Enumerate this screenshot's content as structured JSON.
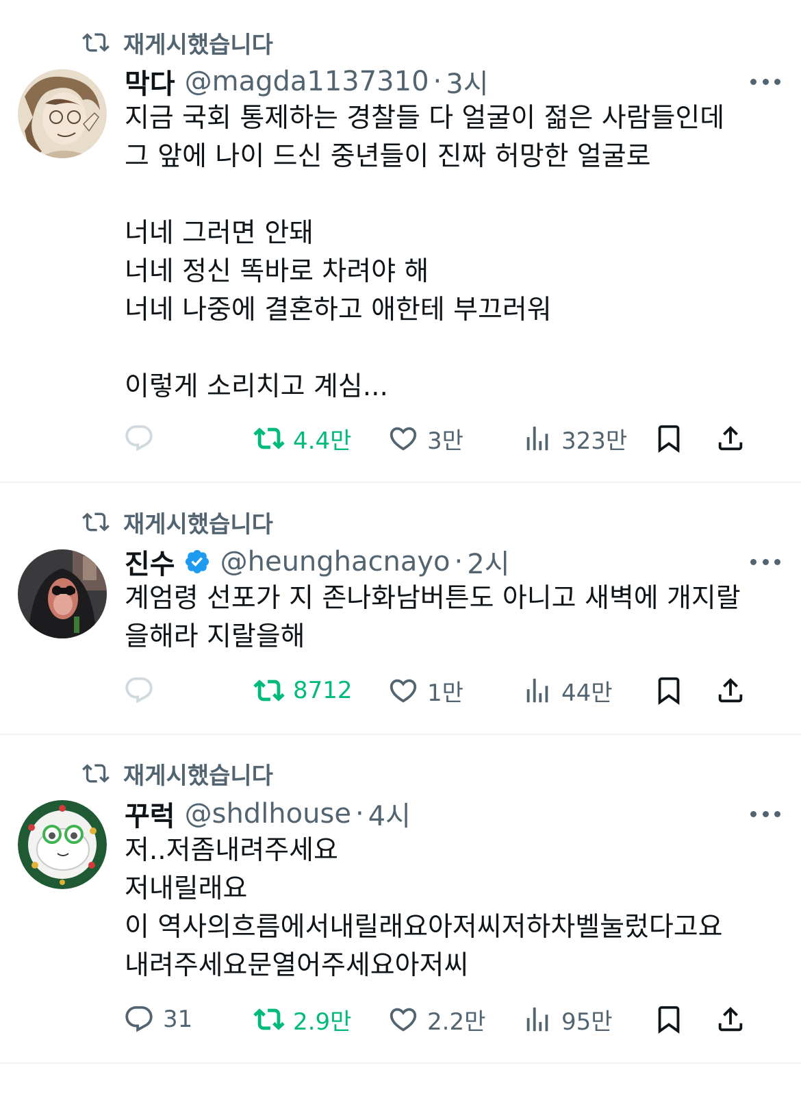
{
  "retweet_label": "재게시했습니다",
  "tweets": [
    {
      "name": "막다",
      "handle": "@magda1137310",
      "separator": "·",
      "time": "3시",
      "lines": [
        "지금 국회 통제하는 경찰들 다 얼굴이 젊은 사람들인데",
        "그 앞에 나이 드신 중년들이 진짜 허망한 얼굴로",
        "",
        "너네 그러면 안돼",
        "너네 정신 똑바로 차려야 해",
        "너네 나중에 결혼하고 애한테 부끄러워",
        "",
        "이렇게 소리치고 계심..."
      ],
      "replies": "",
      "retweets": "4.4만",
      "likes": "3만",
      "views": "323만"
    },
    {
      "name": "진수",
      "verified": true,
      "handle": "@heunghacnayo",
      "separator": "·",
      "time": "2시",
      "lines": [
        "계엄령 선포가 지 존나화남버튼도 아니고 새벽에 개지랄",
        "을해라 지랄을해"
      ],
      "replies": "",
      "retweets": "8712",
      "likes": "1만",
      "views": "44만"
    },
    {
      "name": "꾸럭",
      "handle": "@shdlhouse",
      "separator": "·",
      "time": "4시",
      "lines": [
        "저..저좀내려주세요",
        "저내릴래요",
        "이 역사의흐름에서내릴래요아저씨저하차벨눌렀다고요",
        "내려주세요문열어주세요아저씨"
      ],
      "replies": "31",
      "retweets": "2.9만",
      "likes": "2.2만",
      "views": "95만"
    }
  ],
  "colors": {
    "text": "#0f1419",
    "secondary": "#536471",
    "retweet_green": "#00ba7c",
    "verified_blue": "#1d9bf0",
    "reply_icon_light": "#cfd9de",
    "divider": "#eff3f4"
  },
  "icons": [
    "retweet-icon",
    "reply-icon",
    "like-icon",
    "views-icon",
    "bookmark-icon",
    "share-icon",
    "more-icon",
    "verified-badge-icon"
  ]
}
